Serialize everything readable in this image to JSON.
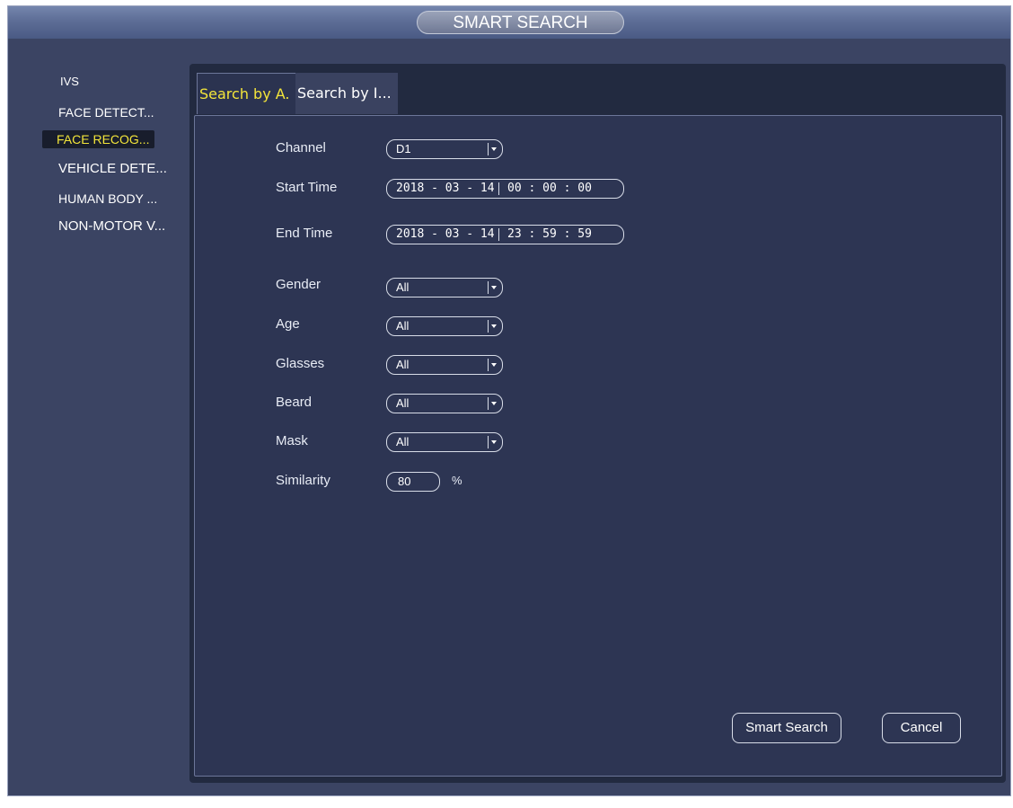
{
  "window": {
    "title": "SMART SEARCH"
  },
  "sidebar": {
    "items": [
      {
        "label": "IVS"
      },
      {
        "label": "FACE DETECT..."
      },
      {
        "label": "FACE RECOG...",
        "active": true
      },
      {
        "label": "VEHICLE DETE..."
      },
      {
        "label": "HUMAN BODY ..."
      },
      {
        "label": "NON-MOTOR V..."
      }
    ]
  },
  "tabs": [
    {
      "label": "Search by A.",
      "active": true
    },
    {
      "label": "Search by I..."
    }
  ],
  "form": {
    "channel": {
      "label": "Channel",
      "value": "D1"
    },
    "start_time": {
      "label": "Start Time",
      "date": "2018 - 03 - 14",
      "time": "00 : 00 : 00"
    },
    "end_time": {
      "label": "End Time",
      "date": "2018 - 03 - 14",
      "time": "23 : 59 : 59"
    },
    "gender": {
      "label": "Gender",
      "value": "All"
    },
    "age": {
      "label": "Age",
      "value": "All"
    },
    "glasses": {
      "label": "Glasses",
      "value": "All"
    },
    "beard": {
      "label": "Beard",
      "value": "All"
    },
    "mask": {
      "label": "Mask",
      "value": "All"
    },
    "similarity": {
      "label": "Similarity",
      "value": "80",
      "unit": "%"
    }
  },
  "buttons": {
    "smart_search": "Smart Search",
    "cancel": "Cancel"
  },
  "colors": {
    "active_text": "#f3e53a",
    "panel_bg": "#2d3553",
    "window_bg": "#3b4463"
  }
}
